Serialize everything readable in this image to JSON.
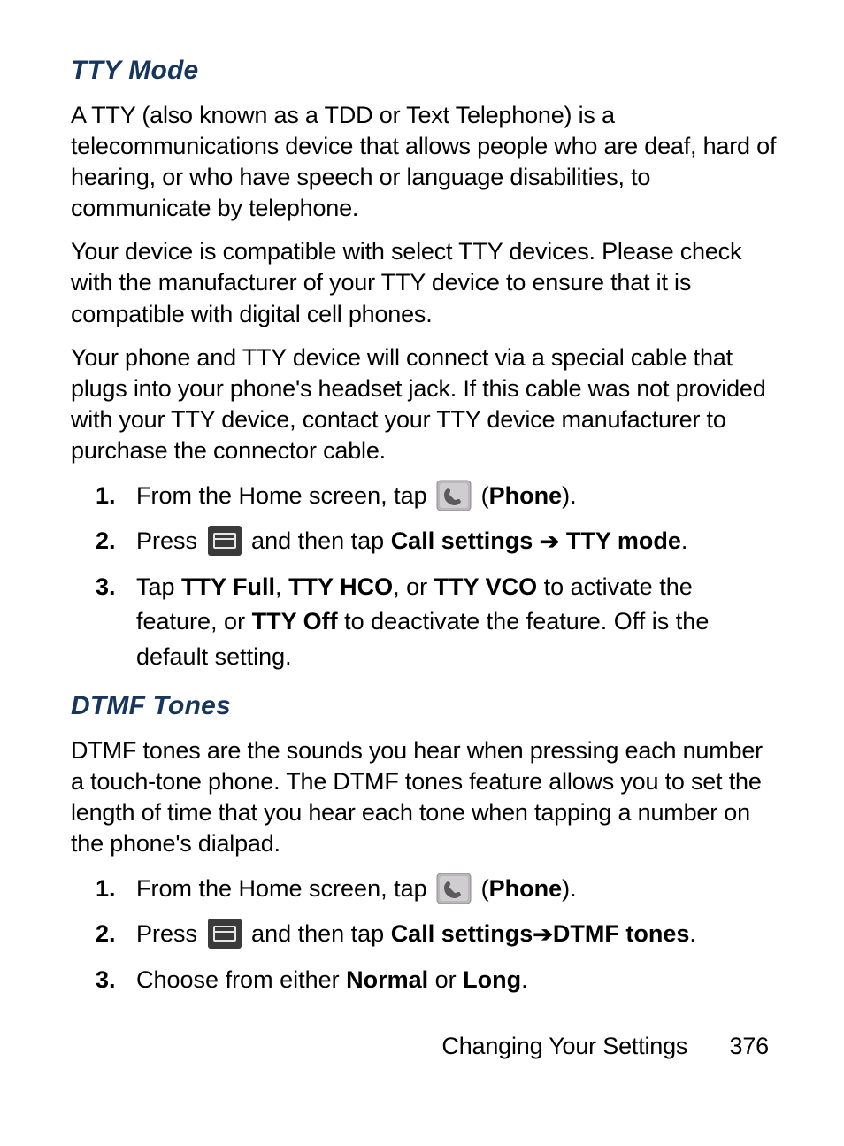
{
  "icons": {
    "phone": "phone-app-icon",
    "menu": "menu-hardkey-icon"
  },
  "sections": [
    {
      "heading": "TTY Mode",
      "paragraphs": [
        "A TTY (also known as a TDD or Text Telephone) is a telecommunications device that allows people who are deaf, hard of hearing, or who have speech or language disabilities, to communicate by telephone.",
        "Your device is compatible with select TTY devices. Please check with the manufacturer of your TTY device to ensure that it is compatible with digital cell phones.",
        "Your phone and TTY device will connect via a special cable that plugs into your phone's headset jack. If this cable was not provided with your TTY device, contact your TTY device manufacturer to purchase the connector cable."
      ],
      "steps": [
        {
          "pre": "From the Home screen, tap ",
          "icon": "phone",
          "openParen": "(",
          "bold1": "Phone",
          "close": ")."
        },
        {
          "pre": "Press ",
          "icon": "menu",
          "mid": " and then tap ",
          "bold1": "Call settings",
          "arrow": " ➔ ",
          "bold2": "TTY mode",
          "end": "."
        },
        {
          "pre": "Tap ",
          "bold1": "TTY Full",
          "sep1": ", ",
          "bold2": "TTY HCO",
          "sep2": ", or ",
          "bold3": "TTY VCO",
          "mid": " to activate the feature, or ",
          "bold4": "TTY Off",
          "end": " to deactivate the feature. Off is the default setting."
        }
      ]
    },
    {
      "heading": "DTMF Tones",
      "paragraphs": [
        "DTMF tones are the sounds you hear when pressing each number a touch-tone phone. The DTMF tones feature allows you to set the length of time that you hear each tone when tapping a number on the phone's dialpad."
      ],
      "steps": [
        {
          "pre": "From the Home screen, tap ",
          "icon": "phone",
          "openParen": "(",
          "bold1": "Phone",
          "close": ")."
        },
        {
          "pre": "Press ",
          "icon": "menu",
          "mid": " and then tap ",
          "bold1": "Call settings",
          "arrow": " ➔ ",
          "bold2": "DTMF tones",
          "end": "."
        },
        {
          "pre": "Choose from either ",
          "bold1": "Normal",
          "sep1": " or ",
          "bold2": "Long",
          "end": "."
        }
      ]
    }
  ],
  "footer": {
    "section": "Changing Your Settings",
    "page": "376"
  }
}
